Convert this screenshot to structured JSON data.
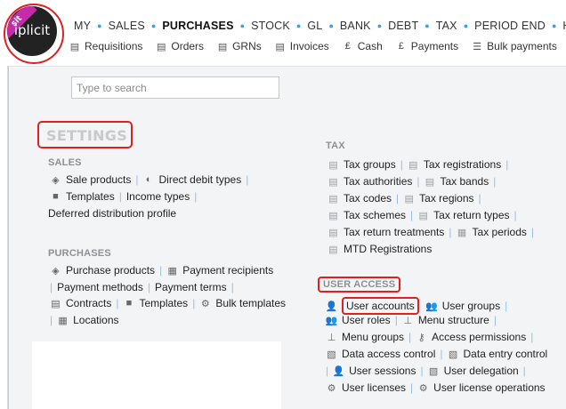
{
  "logo": {
    "badge": "sit",
    "text": "iplicit"
  },
  "topnav": [
    "MY",
    "SALES",
    "PURCHASES",
    "STOCK",
    "GL",
    "BANK",
    "DEBT",
    "TAX",
    "PERIOD END",
    "HR"
  ],
  "topnav_active": "PURCHASES",
  "subnav": [
    {
      "label": "Requisitions",
      "icon": "document-icon"
    },
    {
      "label": "Orders",
      "icon": "document-icon"
    },
    {
      "label": "GRNs",
      "icon": "document-icon"
    },
    {
      "label": "Invoices",
      "icon": "document-icon"
    },
    {
      "label": "Cash",
      "icon": "cash-icon"
    },
    {
      "label": "Payments",
      "icon": "pound-icon"
    },
    {
      "label": "Bulk payments",
      "icon": "list-icon"
    }
  ],
  "search": {
    "placeholder": "Type to search"
  },
  "settings_title": "SETTINGS",
  "sales": {
    "title": "SALES",
    "rows": [
      [
        "Sale products",
        "Direct debit types"
      ],
      [
        "Templates",
        "Income types"
      ],
      [
        "Deferred distribution profile"
      ]
    ]
  },
  "purchases": {
    "title": "PURCHASES",
    "rows": [
      [
        "Purchase products",
        "Payment recipients"
      ],
      [
        "Payment methods",
        "Payment terms"
      ],
      [
        "Contracts",
        "Templates",
        "Bulk templates"
      ],
      [
        "Locations"
      ]
    ]
  },
  "tax": {
    "title": "TAX",
    "rows": [
      [
        "Tax groups",
        "Tax registrations"
      ],
      [
        "Tax authorities",
        "Tax bands"
      ],
      [
        "Tax codes",
        "Tax regions"
      ],
      [
        "Tax schemes",
        "Tax return types"
      ],
      [
        "Tax return treatments",
        "Tax periods"
      ],
      [
        "MTD Registrations"
      ]
    ]
  },
  "user_access": {
    "title": "USER ACCESS",
    "rows": [
      [
        "User accounts",
        "User groups"
      ],
      [
        "User roles",
        "Menu structure"
      ],
      [
        "Menu groups",
        "Access permissions"
      ],
      [
        "Data access control",
        "Data entry control"
      ],
      [
        "User sessions",
        "User delegation"
      ],
      [
        "User licenses",
        "User license operations"
      ]
    ]
  }
}
